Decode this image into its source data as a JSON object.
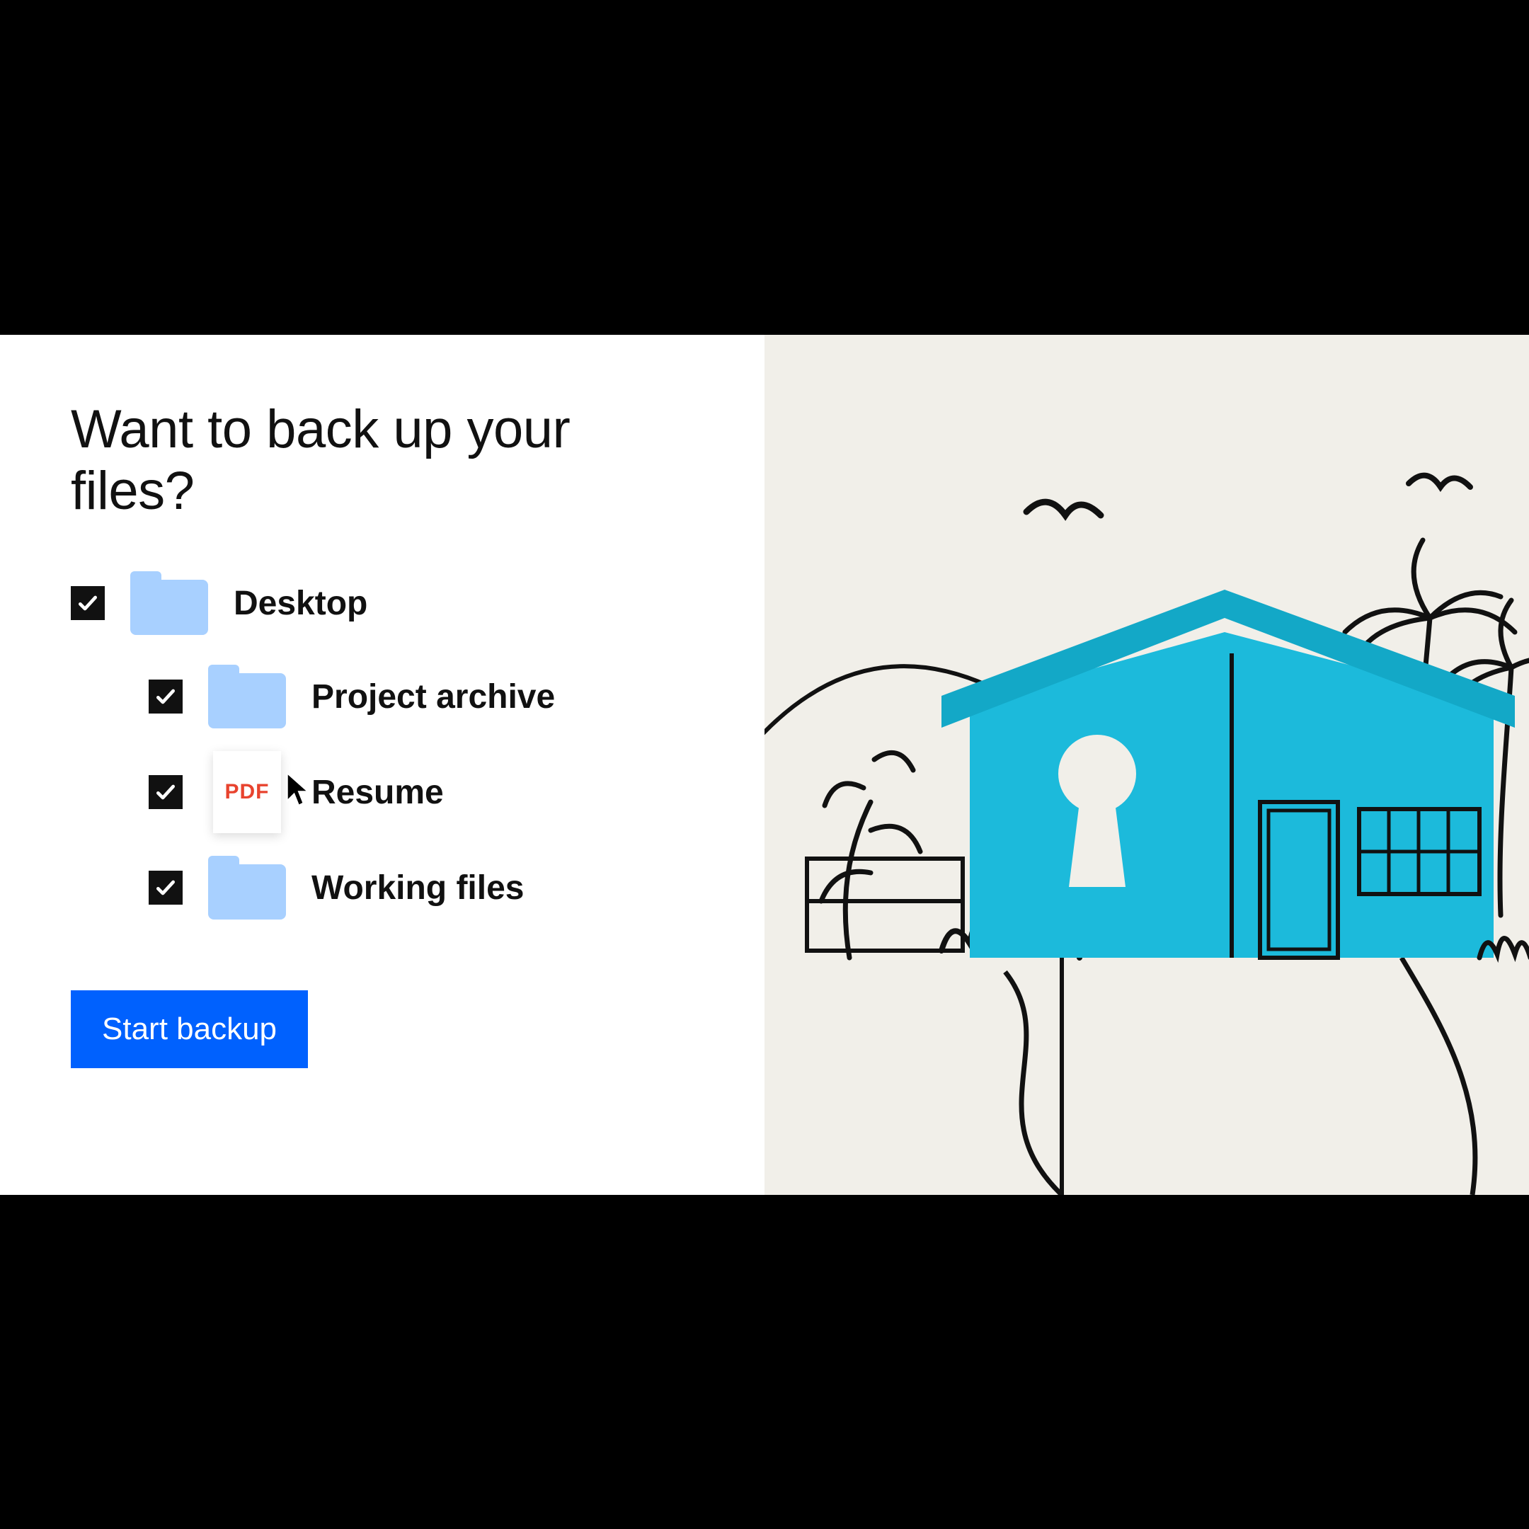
{
  "title": "Want to back up your files?",
  "items": [
    {
      "label": "Desktop",
      "type": "folder",
      "indent": false
    },
    {
      "label": "Project archive",
      "type": "folder",
      "indent": true
    },
    {
      "label": "Resume",
      "type": "pdf",
      "badge": "PDF",
      "indent": true,
      "cursor": true
    },
    {
      "label": "Working files",
      "type": "folder",
      "indent": true
    }
  ],
  "button": "Start backup"
}
